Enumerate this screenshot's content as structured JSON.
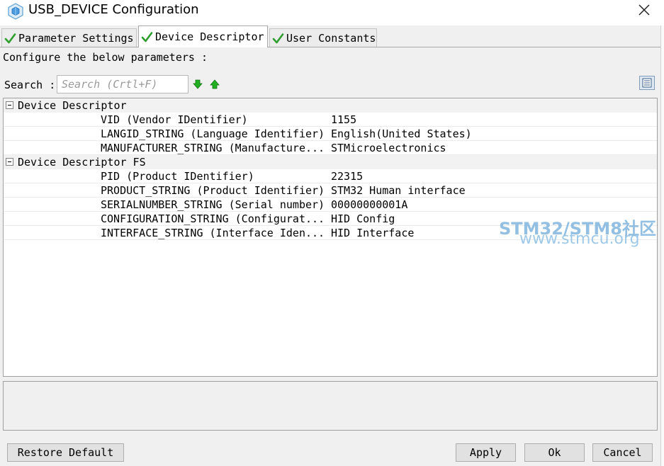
{
  "window": {
    "title": "USB_DEVICE Configuration",
    "icon": "cube-icon"
  },
  "tabs": [
    {
      "label": "Parameter Settings",
      "active": false,
      "icon": "check-icon"
    },
    {
      "label": "Device Descriptor",
      "active": true,
      "icon": "check-icon"
    },
    {
      "label": "User Constants",
      "active": false,
      "icon": "check-icon"
    }
  ],
  "main": {
    "configure_text": "Configure the below parameters :",
    "search_label": "Search :",
    "search_placeholder": "Search (Crtl+F)"
  },
  "tree": {
    "groups": [
      {
        "label": "Device Descriptor",
        "rows": [
          {
            "name": "VID (Vendor IDentifier)",
            "value": "1155"
          },
          {
            "name": "LANGID_STRING (Language Identifier)",
            "value": "English(United States)"
          },
          {
            "name": "MANUFACTURER_STRING (Manufacture...",
            "value": "STMicroelectronics"
          }
        ]
      },
      {
        "label": "Device Descriptor FS",
        "rows": [
          {
            "name": "PID (Product IDentifier)",
            "value": "22315"
          },
          {
            "name": "PRODUCT_STRING (Product Identifier)",
            "value": "STM32 Human interface"
          },
          {
            "name": "SERIALNUMBER_STRING (Serial number)",
            "value": "00000000001A"
          },
          {
            "name": "CONFIGURATION_STRING (Configurat...",
            "value": "HID Config"
          },
          {
            "name": "INTERFACE_STRING (Interface Iden...",
            "value": "HID Interface"
          }
        ]
      }
    ]
  },
  "buttons": {
    "restore": "Restore Default",
    "apply": "Apply",
    "ok": "Ok",
    "cancel": "Cancel"
  },
  "watermark": {
    "line1": "STM32/STM8社区",
    "line2": "www.stmcu.org"
  },
  "colors": {
    "check_green": "#2e9e2e",
    "arrow_green": "#22b022",
    "watermark_blue": "#7fb5de"
  }
}
